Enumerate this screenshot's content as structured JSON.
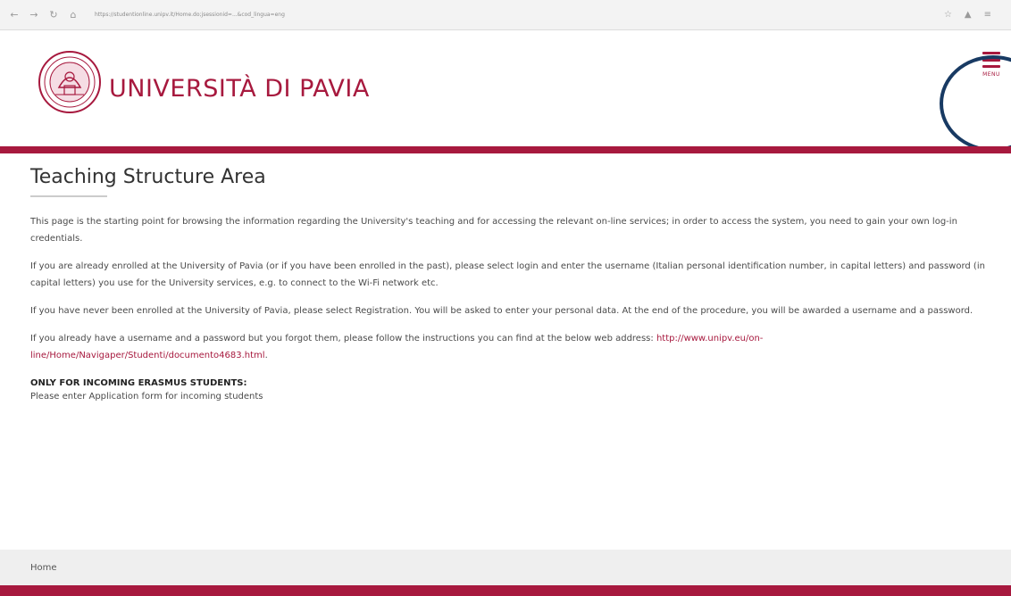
{
  "browser": {
    "url": "https://studentionline.unipv.it/Home.do;jsessionid=...&cod_lingua=eng"
  },
  "header": {
    "brand": "UNIVERSITÀ DI PAVIA",
    "menu_label": "MENU",
    "accent_color": "#a7193e"
  },
  "main": {
    "title": "Teaching Structure Area",
    "paragraphs": [
      "This page is the starting point for browsing the information regarding the University's teaching and for accessing the relevant on-line services; in order to access the system, you need to gain your own log-in credentials.",
      "If you are already enrolled at the University of Pavia (or if you have been enrolled in the past), please select login and enter the username (Italian personal identification number, in capital letters) and password (in capital letters) you use for the University services, e.g. to connect to the Wi-Fi network etc.",
      "If you have never been enrolled at the University of Pavia, please select Registration. You will be asked to enter your personal data. At the end of the procedure, you will be awarded a username and a password."
    ],
    "forgot_text": "If you already have a username and a password but you forgot them, please follow the instructions you can find at the below web address: ",
    "forgot_link": "http://www.unipv.eu/on-line/Home/Navigaper/Studenti/documento4683.html",
    "forgot_end": ".",
    "erasmus_heading": "ONLY FOR INCOMING ERASMUS STUDENTS:",
    "erasmus_text": "Please enter Application form for incoming students"
  },
  "breadcrumb": {
    "home": "Home"
  }
}
